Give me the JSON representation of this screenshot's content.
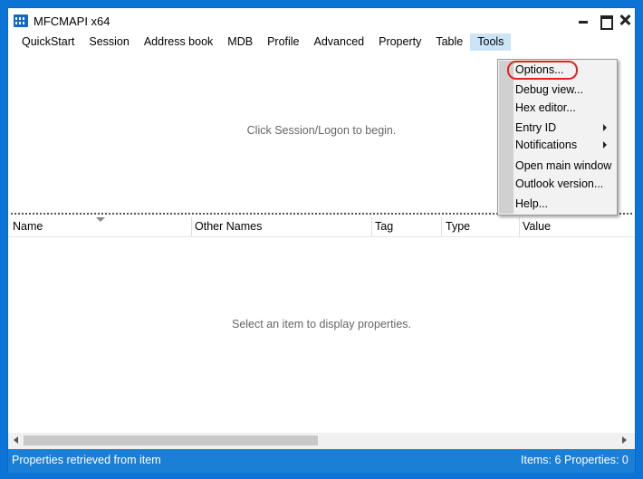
{
  "window": {
    "title": "MFCMAPI x64"
  },
  "menu": {
    "items": [
      "QuickStart",
      "Session",
      "Address book",
      "MDB",
      "Profile",
      "Advanced",
      "Property",
      "Table",
      "Tools"
    ],
    "active": "Tools"
  },
  "upper_pane": {
    "hint": "Click Session/Logon to begin."
  },
  "table": {
    "columns": [
      "Name",
      "Other Names",
      "Tag",
      "Type",
      "Value"
    ]
  },
  "lower_pane": {
    "hint": "Select an item to display properties."
  },
  "status": {
    "left": "Properties retrieved from item",
    "items": "Items: 6",
    "properties": "Properties: 0"
  },
  "tools_menu": {
    "items": [
      {
        "label": "Options...",
        "submenu": false,
        "highlighted": true
      },
      {
        "label": "Debug view...",
        "submenu": false
      },
      {
        "label": "Hex editor...",
        "submenu": false
      },
      {
        "label": "Entry ID",
        "submenu": true
      },
      {
        "label": "Notifications",
        "submenu": true
      },
      {
        "label": "Open main window",
        "submenu": false
      },
      {
        "label": "Outlook version...",
        "submenu": false
      },
      {
        "label": "Help...",
        "submenu": false
      }
    ]
  },
  "colors": {
    "desktop": "#0b74d6",
    "statusbar": "#1c7fd6",
    "menu_active": "#cce4f7",
    "highlight_ring": "#e0241f"
  }
}
